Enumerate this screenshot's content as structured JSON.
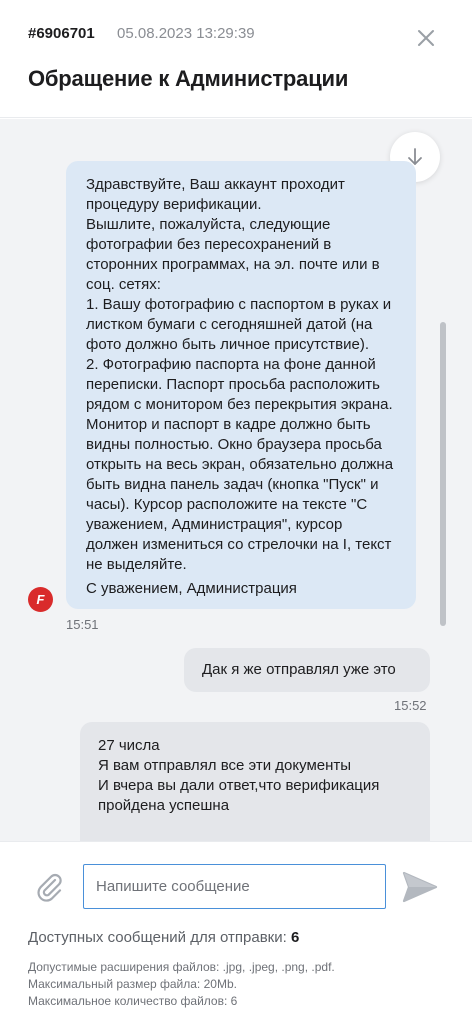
{
  "header": {
    "ticket_id": "#6906701",
    "date": "05.08.2023 13:29:39",
    "title": "Обращение к Администрации",
    "close_icon": "close-icon"
  },
  "messages": [
    {
      "sender": "admin",
      "avatar_letter": "F",
      "lines": [
        "Здравствуйте, Ваш аккаунт проходит",
        "процедуру верификации.",
        "Вышлите, пожалуйста, следующие",
        "фотографии без пересохранений в",
        "сторонних программах, на эл. почте или в",
        "соц. сетях:",
        "1. Вашу фотографию с паспортом в руках и",
        "листком бумаги с сегодняшней датой (на",
        "фото должно быть личное присутствие).",
        "2. Фотографию паспорта на фоне данной",
        "переписки. Паспорт просьба расположить",
        "рядом с монитором без перекрытия экрана.",
        "Монитор и паспорт в кадре должно быть",
        "видны полностью. Окно браузера просьба",
        "открыть на весь экран, обязательно должна",
        "быть видна панель задач (кнопка \"Пуск\" и",
        "часы). Курсор расположите на тексте \"С",
        "уважением, Администрация\", курсор",
        "должен измениться со стрелочки на I, текст",
        "не выделяйте."
      ],
      "signature": "С уважением, Администрация",
      "time": "15:51"
    },
    {
      "sender": "user",
      "text": "Дак я же отправлял уже это",
      "time": "15:52"
    },
    {
      "sender": "user",
      "lines": [
        "27 числа",
        "Я вам отправлял все эти документы",
        "И вчера вы дали ответ,что верификация",
        "пройдена успешна"
      ]
    }
  ],
  "composer": {
    "placeholder": "Напишите сообщение",
    "value": "",
    "attach_icon": "paperclip-icon",
    "send_icon": "send-icon",
    "available_label": "Доступных сообщений для отправки:",
    "available_count": "6",
    "info": [
      "Допустимые расширения файлов: .jpg, .jpeg, .png, .pdf.",
      "Максимальный размер файла: 20Mb.",
      "Максимальное количество файлов: 6"
    ]
  },
  "colors": {
    "admin_bubble": "#dce8f5",
    "user_bubble": "#e4e6ea",
    "chat_background": "#f2f3f5",
    "avatar": "#d92b2b",
    "input_border": "#4a90d9"
  }
}
